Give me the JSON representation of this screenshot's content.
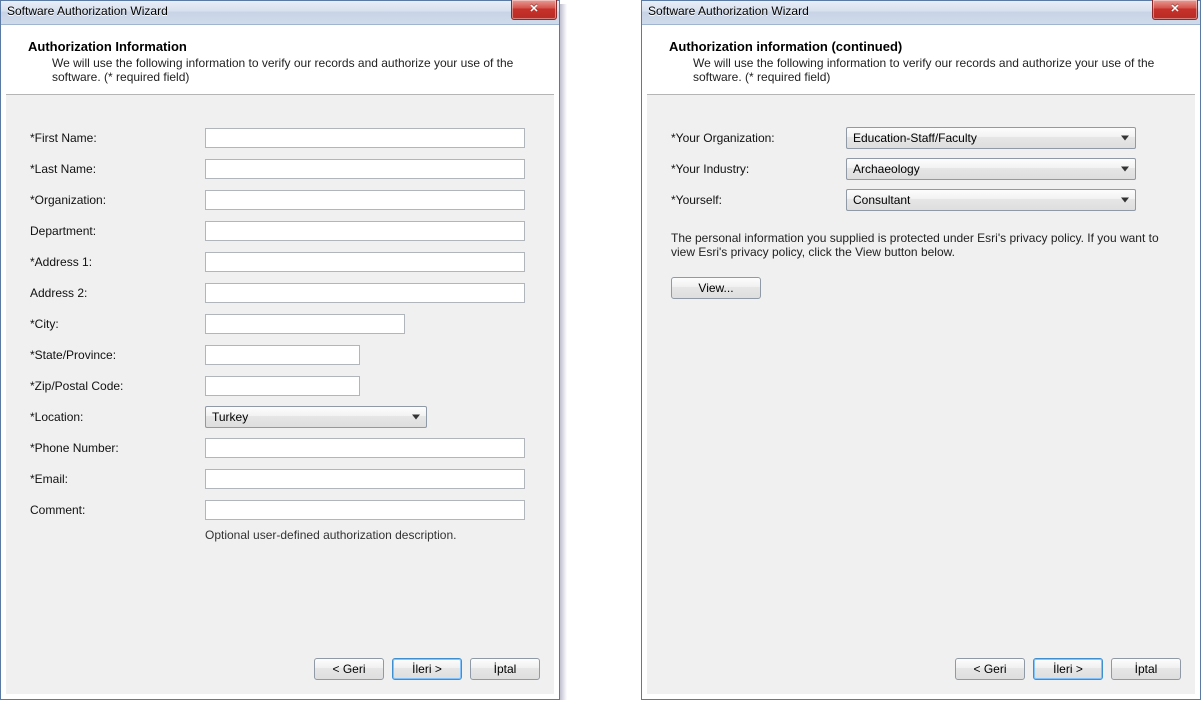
{
  "left": {
    "title": "Software Authorization Wizard",
    "header_title": "Authorization Information",
    "header_sub": "We will use the following information to verify our records and authorize your use of the software. (* required field)",
    "fields": {
      "first_name": {
        "label": "*First Name:",
        "value": ""
      },
      "last_name": {
        "label": "*Last Name:",
        "value": ""
      },
      "organization": {
        "label": "*Organization:",
        "value": ""
      },
      "department": {
        "label": "Department:",
        "value": ""
      },
      "address1": {
        "label": "*Address 1:",
        "value": ""
      },
      "address2": {
        "label": "Address 2:",
        "value": ""
      },
      "city": {
        "label": "*City:",
        "value": ""
      },
      "state": {
        "label": "*State/Province:",
        "value": ""
      },
      "zip": {
        "label": "*Zip/Postal Code:",
        "value": ""
      },
      "location": {
        "label": "*Location:",
        "value": "Turkey"
      },
      "phone": {
        "label": "*Phone Number:",
        "value": ""
      },
      "email": {
        "label": "*Email:",
        "value": ""
      },
      "comment": {
        "label": "Comment:",
        "value": ""
      }
    },
    "comment_hint": "Optional user-defined authorization description.",
    "nav": {
      "back": "< Geri",
      "next": "İleri >",
      "cancel": "İptal"
    }
  },
  "right": {
    "title": "Software Authorization Wizard",
    "header_title": "Authorization information (continued)",
    "header_sub": "We will use the following information to verify our records and authorize your use of the software. (* required field)",
    "fields": {
      "org": {
        "label": "*Your Organization:",
        "value": "Education-Staff/Faculty"
      },
      "industry": {
        "label": "*Your Industry:",
        "value": "Archaeology"
      },
      "yourself": {
        "label": "*Yourself:",
        "value": "Consultant"
      }
    },
    "note": "The personal information you supplied is protected under Esri's privacy policy. If you want to view Esri's privacy policy, click the View button below.",
    "view_label": "View...",
    "nav": {
      "back": "< Geri",
      "next": "İleri >",
      "cancel": "İptal"
    }
  }
}
